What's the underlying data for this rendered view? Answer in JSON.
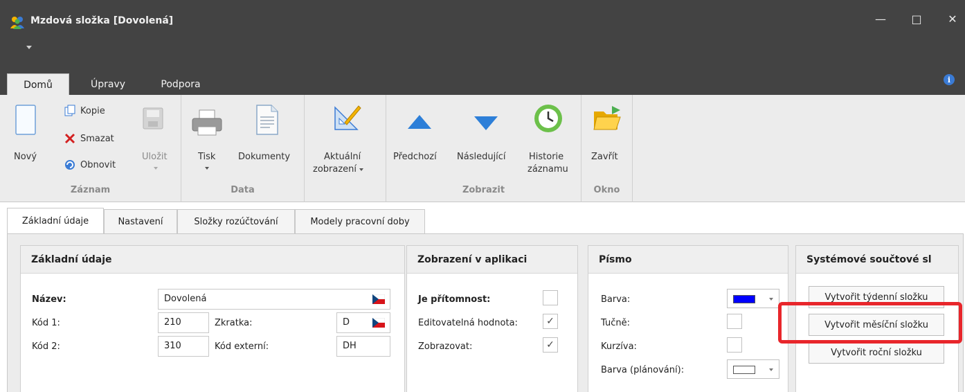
{
  "window": {
    "title": "Mzdová složka [Dovolená]",
    "minimize": "—",
    "maximize": "□",
    "close": "✕"
  },
  "ribbon_tabs": [
    {
      "label": "Domů",
      "active": true
    },
    {
      "label": "Úpravy",
      "active": false
    },
    {
      "label": "Podpora",
      "active": false
    }
  ],
  "ribbon": {
    "zaznam": {
      "label": "Záznam",
      "novy": "Nový",
      "kopie": "Kopie",
      "smazat": "Smazat",
      "obnovit": "Obnovit",
      "ulozit": "Uložit"
    },
    "data": {
      "label": "Data",
      "tisk": "Tisk",
      "dokumenty": "Dokumenty"
    },
    "view": {
      "aktualni_1": "Aktuální",
      "aktualni_2": "zobrazení"
    },
    "zobrazit": {
      "label": "Zobrazit",
      "predchozi": "Předchozí",
      "nasledujici": "Následující",
      "historie_1": "Historie",
      "historie_2": "záznamu"
    },
    "okno": {
      "label": "Okno",
      "zavrit": "Zavřít"
    }
  },
  "doc_tabs": [
    {
      "label": "Základní údaje",
      "active": true
    },
    {
      "label": "Nastavení",
      "active": false
    },
    {
      "label": "Složky rozúčtování",
      "active": false
    },
    {
      "label": "Modely pracovní doby",
      "active": false
    }
  ],
  "zakladni": {
    "title": "Základní údaje",
    "nazev_label": "Název:",
    "nazev_value": "Dovolená",
    "kod1_label": "Kód 1:",
    "kod1_value": "210",
    "zkratka_label": "Zkratka:",
    "zkratka_value": "D",
    "kod2_label": "Kód 2:",
    "kod2_value": "310",
    "kod_ext_label": "Kód externí:",
    "kod_ext_value": "DH"
  },
  "zobrazeni": {
    "title": "Zobrazení v aplikaci",
    "pritomnost_label": "Je přítomnost:",
    "pritomnost_checked": false,
    "editovatelna_label": "Editovatelná hodnota:",
    "editovatelna_checked": true,
    "zobrazovat_label": "Zobrazovat:",
    "zobrazovat_checked": true,
    "check_mark": "✓"
  },
  "pismo": {
    "title": "Písmo",
    "barva_label": "Barva:",
    "barva_color": "#0000ff",
    "tucne_label": "Tučně:",
    "kurziva_label": "Kurzíva:",
    "barva_plan_label": "Barva (plánování):",
    "barva_plan_color": "#ffffff"
  },
  "system": {
    "title": "Systémové součtové sl",
    "tydenni": "Vytvořit týdenní složku",
    "mesicni": "Vytvořit měsíční složku",
    "rocni": "Vytvořit roční složku"
  },
  "colors": {
    "titlebar": "#434343",
    "ribbon": "#ececec",
    "highlight": "#e8262b"
  }
}
